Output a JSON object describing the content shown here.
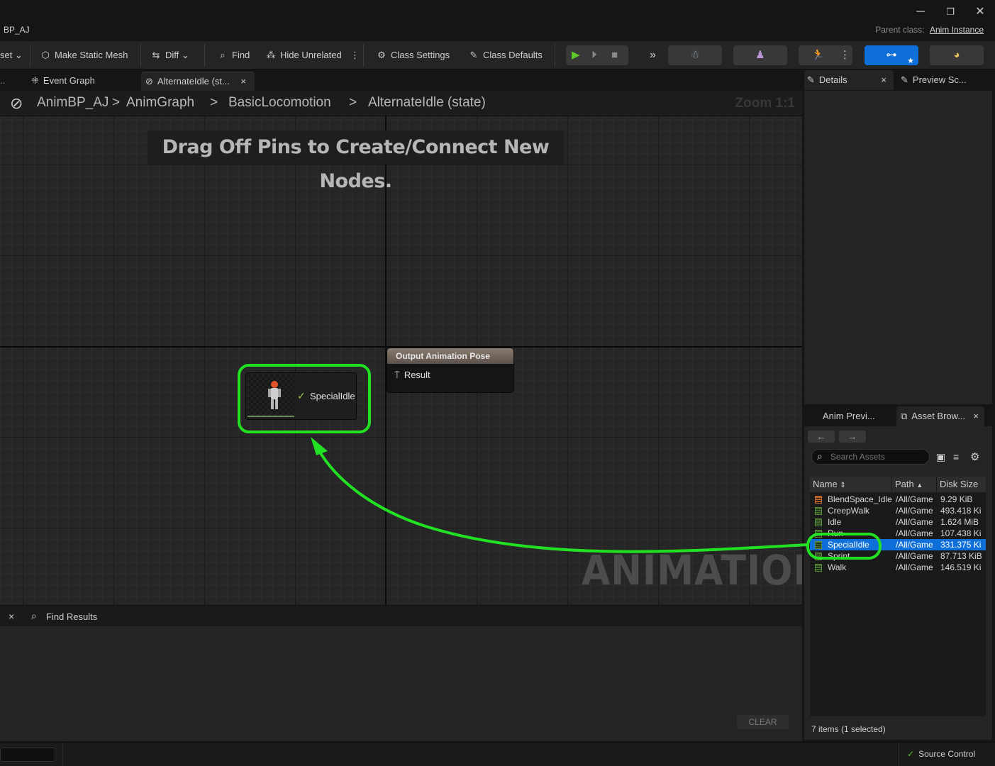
{
  "window": {
    "title": "BP_AJ",
    "parent_class_label": "Parent class:",
    "parent_class_value": "Anim Instance",
    "minimize": "─",
    "maximize": "❐",
    "close": "✕"
  },
  "toolbar": {
    "asset_label": "set",
    "make_static_mesh": "Make Static Mesh",
    "diff": "Diff",
    "find": "Find",
    "hide_unrelated": "Hide Unrelated",
    "class_settings": "Class Settings",
    "class_defaults": "Class Defaults"
  },
  "tabs": {
    "event_graph": "Event Graph",
    "alternate_idle": "AlternateIdle (st...",
    "close": "×"
  },
  "breadcrumb": {
    "items": [
      "AnimBP_AJ",
      "AnimGraph",
      "BasicLocomotion",
      "AlternateIdle (state)"
    ],
    "separator": ">",
    "zoom": "Zoom 1:1"
  },
  "graph": {
    "hint": "Drag Off Pins to Create/Connect New Nodes.",
    "watermark": "ANIMATION",
    "output_node": {
      "title": "Output Animation Pose",
      "pin": "Result"
    },
    "anim_node": {
      "label": "SpecialIdle"
    }
  },
  "find_panel": {
    "close": "×",
    "title": "Find Results",
    "clear": "CLEAR"
  },
  "details_panel": {
    "details_tab": "Details",
    "preview_tab": "Preview Sc...",
    "close": "×"
  },
  "asset_browser": {
    "anim_preview_tab": "Anim Previ...",
    "asset_browser_tab": "Asset Brow...",
    "close": "×",
    "search_placeholder": "Search Assets",
    "columns": {
      "name": "Name",
      "path": "Path",
      "size": "Disk Size"
    },
    "rows": [
      {
        "name": "BlendSpace_Idle",
        "path": "/All/Game",
        "size": "9.29 KiB",
        "icon": "blendspace-icon"
      },
      {
        "name": "CreepWalk",
        "path": "/All/Game",
        "size": "493.418 Ki",
        "icon": "anim-sequence-icon"
      },
      {
        "name": "Idle",
        "path": "/All/Game",
        "size": "1.624 MiB",
        "icon": "anim-sequence-icon"
      },
      {
        "name": "Run",
        "path": "/All/Game",
        "size": "107.438 Ki",
        "icon": "anim-sequence-icon"
      },
      {
        "name": "SpecialIdle",
        "path": "/All/Game",
        "size": "331.375 Ki",
        "icon": "anim-sequence-icon",
        "selected": true
      },
      {
        "name": "Sprint",
        "path": "/All/Game",
        "size": "87.713 KiB",
        "icon": "anim-sequence-icon"
      },
      {
        "name": "Walk",
        "path": "/All/Game",
        "size": "146.519 Ki",
        "icon": "anim-sequence-icon"
      }
    ],
    "footer": "7 items (1 selected)"
  },
  "status_bar": {
    "source_control": "Source Control"
  },
  "colors": {
    "highlight_green": "#22e022",
    "selection_blue": "#0e6fd8",
    "play_green": "#5fc72a",
    "mode_blue": "#0e6fd8"
  }
}
